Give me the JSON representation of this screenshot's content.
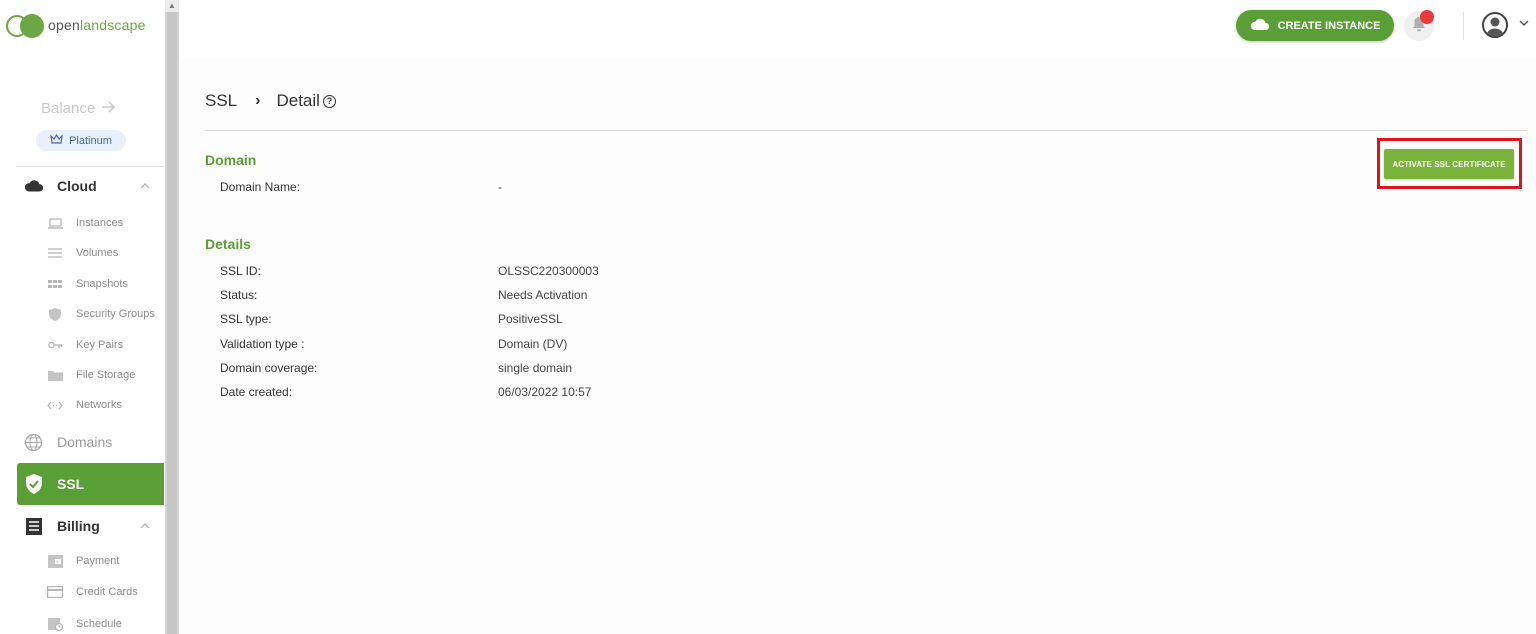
{
  "brand": {
    "logo_text_a": "open",
    "logo_text_b": "landscape"
  },
  "sidebar": {
    "balance_label": "Balance",
    "tier_label": "Platinum",
    "cloud": {
      "label": "Cloud",
      "items": [
        {
          "label": "Instances",
          "icon": "laptop-icon"
        },
        {
          "label": "Volumes",
          "icon": "lines-icon"
        },
        {
          "label": "Snapshots",
          "icon": "grid-icon"
        },
        {
          "label": "Security Groups",
          "icon": "shield-icon"
        },
        {
          "label": "Key Pairs",
          "icon": "key-icon"
        },
        {
          "label": "File Storage",
          "icon": "folder-icon"
        },
        {
          "label": "Networks",
          "icon": "code-arrows-icon"
        }
      ]
    },
    "domains_label": "Domains",
    "ssl_label": "SSL",
    "billing": {
      "label": "Billing",
      "items": [
        {
          "label": "Payment",
          "icon": "wallet-icon"
        },
        {
          "label": "Credit Cards",
          "icon": "card-icon"
        },
        {
          "label": "Schedule",
          "icon": "calendar-icon"
        }
      ]
    }
  },
  "topbar": {
    "create_label": "CREATE INSTANCE"
  },
  "breadcrumb": {
    "root": "SSL",
    "current": "Detail",
    "help": "?"
  },
  "domain_section": {
    "title": "Domain",
    "rows": [
      {
        "label": "Domain Name:",
        "value": "-"
      }
    ]
  },
  "details_section": {
    "title": "Details",
    "rows": [
      {
        "label": "SSL ID:",
        "value": "OLSSC220300003"
      },
      {
        "label": "Status:",
        "value": "Needs Activation"
      },
      {
        "label": "SSL type:",
        "value": "PositiveSSL"
      },
      {
        "label": "Validation type :",
        "value": "Domain (DV)"
      },
      {
        "label": "Domain coverage:",
        "value": "single domain"
      },
      {
        "label": "Date created:",
        "value": "06/03/2022 10:57"
      }
    ]
  },
  "activate_button": {
    "label": "ACTIVATE SSL CERTIFICATE"
  },
  "colors": {
    "brand_green": "#5a9f35",
    "button_green": "#7ab33a",
    "highlight_red": "#e0121b",
    "notification_red": "#e93a3a"
  }
}
